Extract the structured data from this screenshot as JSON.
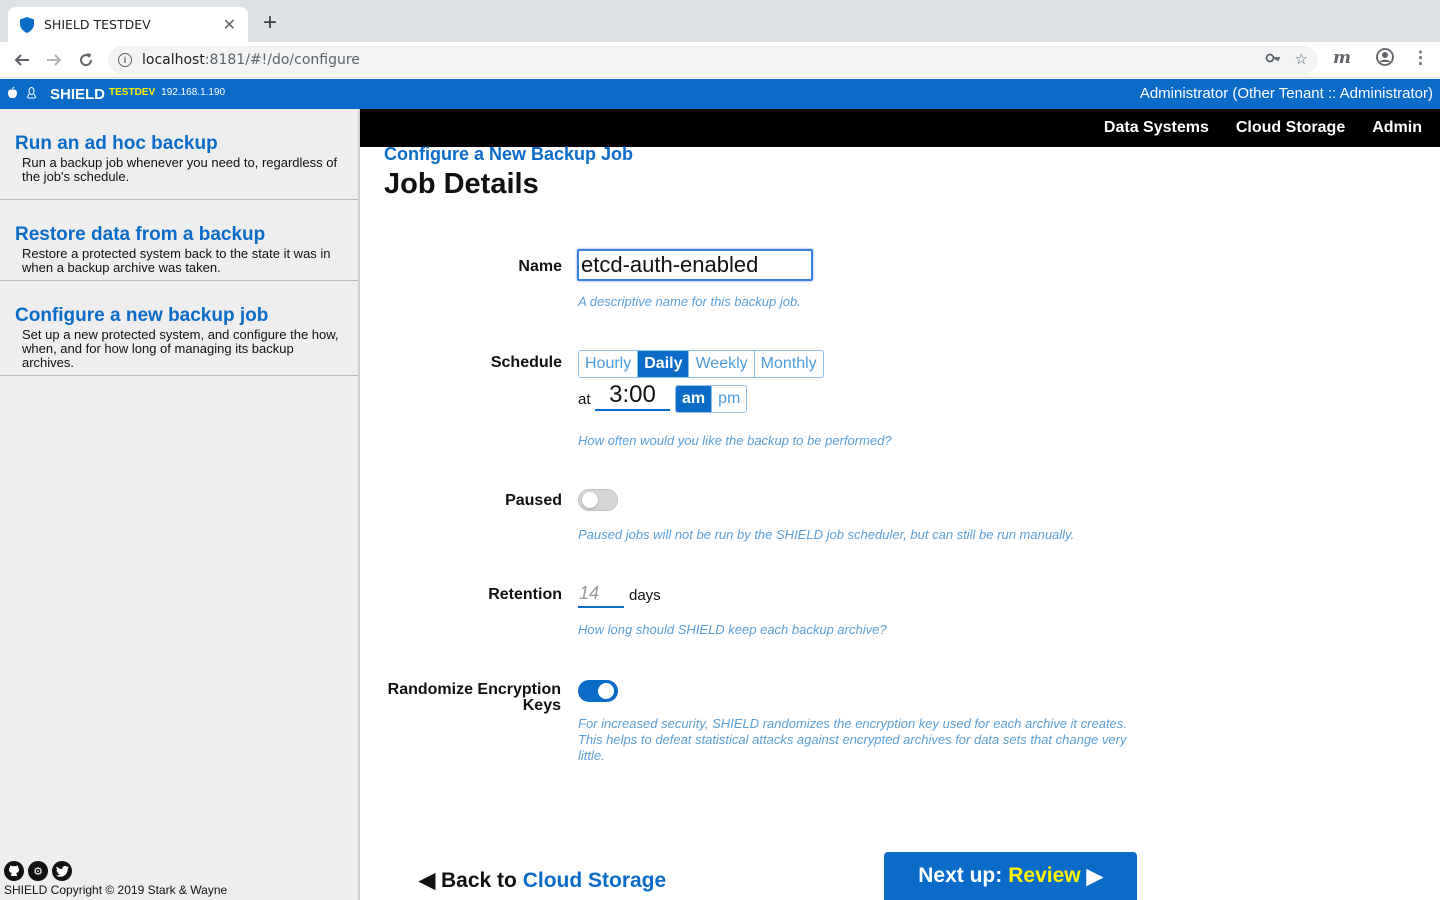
{
  "browser": {
    "tab_title": "SHIELD TESTDEV",
    "tab_close": "✕",
    "new_tab": "+",
    "url_host": "localhost",
    "url_path": ":8181/#!/do/configure"
  },
  "appbar": {
    "brand": "SHIELD",
    "env": "TESTDEV",
    "ip": "192.168.1.190",
    "user": "Administrator (Other Tenant :: Administrator)"
  },
  "sidebar": {
    "items": [
      {
        "title": "Run an ad hoc backup",
        "desc": "Run a backup job whenever you need to, regardless of the job's schedule."
      },
      {
        "title": "Restore data from a backup",
        "desc": "Restore a protected system back to the state it was in when a backup archive was taken."
      },
      {
        "title": "Configure a new backup job",
        "desc": "Set up a new protected system, and configure the how, when, and for how long of managing its backup archives."
      }
    ],
    "copyright": "SHIELD Copyright © 2019 Stark & Wayne"
  },
  "topnav": [
    "Data Systems",
    "Cloud Storage",
    "Admin"
  ],
  "main": {
    "crumb": "Configure a New Backup Job",
    "title": "Job Details"
  },
  "form": {
    "name_label": "Name",
    "name_value": "etcd-auth-enabled",
    "name_hint": "A descriptive name for this backup job.",
    "schedule_label": "Schedule",
    "schedule_options": [
      "Hourly",
      "Daily",
      "Weekly",
      "Monthly"
    ],
    "schedule_selected": "Daily",
    "at_label": "at",
    "time_value": "3:00",
    "ampm_options": [
      "am",
      "pm"
    ],
    "ampm_selected": "am",
    "schedule_hint": "How often would you like the backup to be performed?",
    "paused_label": "Paused",
    "paused_value": false,
    "paused_hint": "Paused jobs will not be run by the SHIELD job scheduler, but can still be run manually.",
    "retention_label": "Retention",
    "retention_placeholder": "14",
    "retention_unit": "days",
    "retention_hint": "How long should SHIELD keep each backup archive?",
    "randomize_label": "Randomize Encryption Keys",
    "randomize_value": true,
    "randomize_hint": "For increased security, SHIELD randomizes the encryption key used for each archive it creates. This helps to defeat statistical attacks against encrypted archives for data sets that change very little."
  },
  "footer_nav": {
    "back_prefix": "◀ Back to",
    "back_target": "Cloud Storage",
    "next_prefix": "Next up:",
    "next_target": "Review",
    "next_arrow": "▶"
  },
  "colors": {
    "brand_blue": "#0a6bc8",
    "highlight_yellow": "#fff200",
    "hint_blue": "#5aa0d8"
  }
}
